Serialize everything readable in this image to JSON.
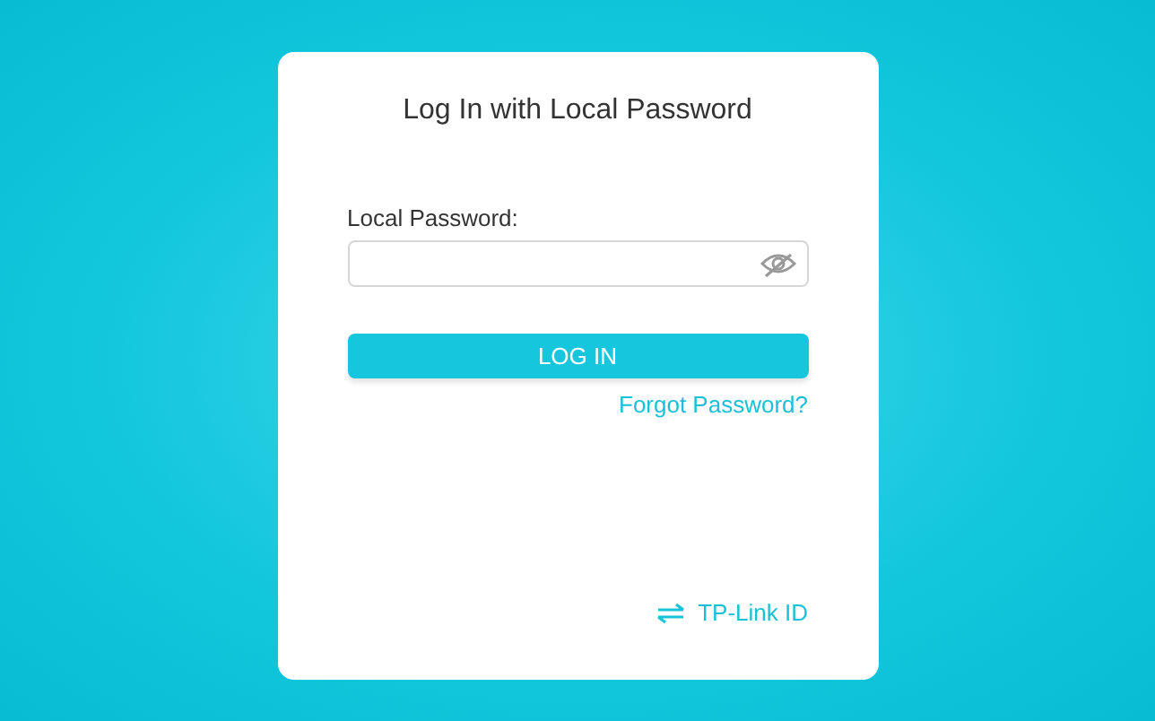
{
  "dialog": {
    "title": "Log In with Local Password",
    "password_label": "Local Password:",
    "password_field": {
      "show_password": false
    },
    "login_button": "LOG IN",
    "forgot_link": "Forgot Password?",
    "switch_link": "TP-Link ID"
  }
}
